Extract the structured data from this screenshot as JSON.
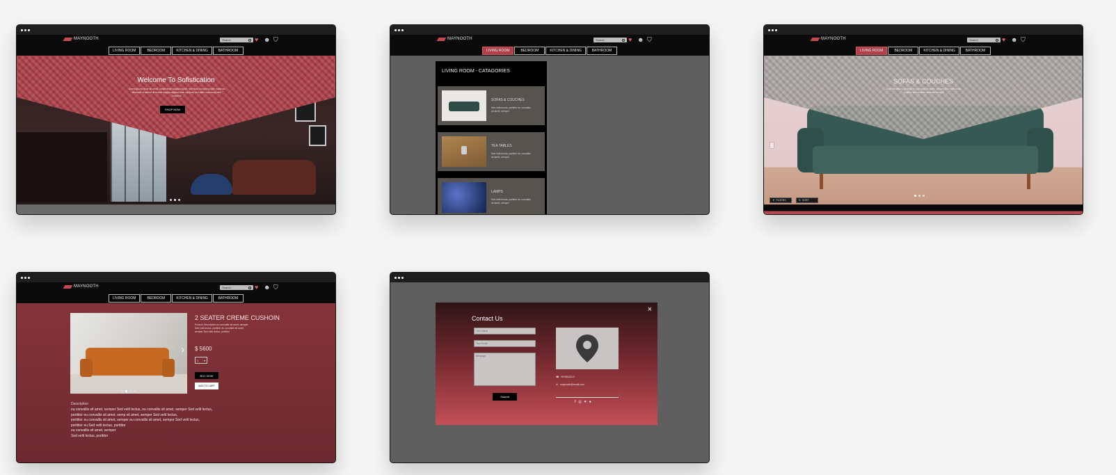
{
  "header": {
    "logo": "MAYNOOTH",
    "search_placeholder": "Search"
  },
  "nav": [
    "LIVING ROOM",
    "BEDROOM",
    "KITCHEN & DINING",
    "BATHROOM"
  ],
  "icons": {
    "search": "search-icon",
    "wishlist": "heart-icon",
    "account": "user-icon",
    "cart": "basket-icon",
    "menu": "window-dots-icon",
    "pin": "map-pin-icon",
    "close": "close-icon"
  },
  "colors": {
    "brand": "#b3474f",
    "dark": "#0a0a0a",
    "overlay": "#5f5f5f"
  },
  "home": {
    "title": "Welcome To Sofistication",
    "body": "Lorem ipsum dolor sit amet, consectetur adipiscing elit, sed diam nonummy nibh euismod tincidunt ut laoreet et dolore magna aliquam erat volutpat, sed diam nonummy nibh euismod",
    "cta": "SHOP NOW"
  },
  "categories": {
    "heading": "LIVING ROOM - CATAGORIES",
    "items": [
      {
        "name": "SOFAS & COUCHES",
        "desc": "Sed velit lectus, porttitor eu convallis sit amet, semper"
      },
      {
        "name": "TEA TABLES",
        "desc": "Sed velit lectus, porttitor eu convallis sit amet, semper"
      },
      {
        "name": "LAMPS",
        "desc": "Sed velit lectus, porttitor eu convallis sit amet, semper"
      }
    ]
  },
  "sofas": {
    "title": "SOFAS & COUCHES",
    "body": "Sed velit lectus, porttitor eu convallis sit amet, semper Sed velit lectus, porttitor eu convallis sit amet, semper",
    "filters": "FILTERS",
    "sort": "SORT"
  },
  "product": {
    "title": "2 SEATER CREME CUSHOIN",
    "desc": "Product Description eu convallis sit amet, semper Sed velit lectus, porttitor eu convallis sit amet, semper Sed velit lectus, porttitor",
    "price": "$ 5600",
    "qty": "1",
    "buy": "BUY NOW",
    "add": "ADD TO CART",
    "desc_title": "Description",
    "desc_lines": [
      "eu convallis sit amet, semper  Sed velit lectus,  eu convallis sit amet, semper  Sed velit lectus,",
      "porttitor eu convallis sit amet, semp sit amet, semper  Sed velit lectus,",
      "porttitor eu convallis sit amet, semper  eu convallis sit amet, semper  Sed velit lectus,",
      "porttitor eu Sed velit lectus, porttitor",
      "eu convallis sit amet, semper",
      "Sed velit lectus, porttitor"
    ]
  },
  "contact": {
    "title": "Contact Us",
    "name_ph": "Your Name",
    "email_ph": "Your Email",
    "msg_ph": "Message",
    "submit": "Submit",
    "phone": "9876543210",
    "email": "maynooth@email.com"
  }
}
